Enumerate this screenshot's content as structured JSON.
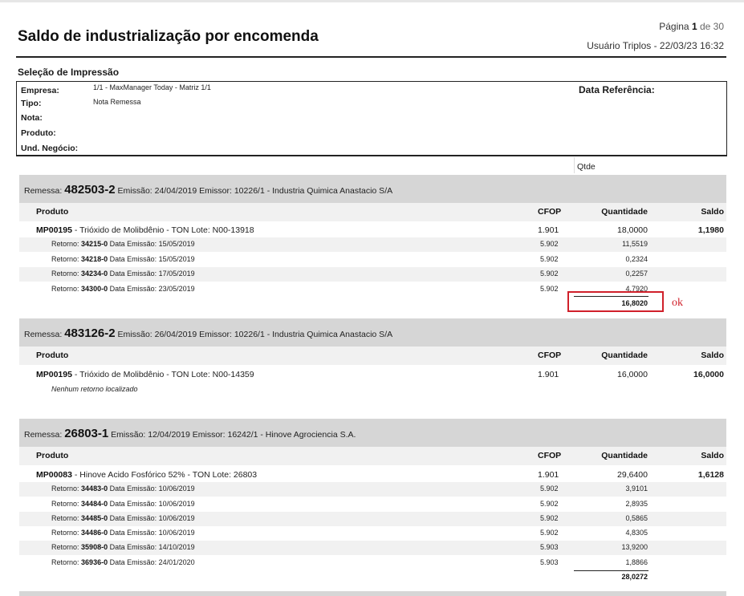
{
  "header": {
    "title": "Saldo de industrialização por encomenda",
    "page_word": "Página",
    "page_num": "1",
    "page_of": "de 30",
    "user_line": "Usuário Triplos - 22/03/23 16:32"
  },
  "selection": {
    "heading": "Seleção de Impressão",
    "empresa_label": "Empresa:",
    "empresa_value": "1/1 - MaxManager Today - Matriz 1/1",
    "tipo_label": "Tipo:",
    "tipo_value": "Nota Remessa",
    "nota_label": "Nota:",
    "produto_label": "Produto:",
    "und_label": "Und. Negócio:",
    "data_ref_label": "Data Referência:"
  },
  "qtde_label": "Qtde",
  "columns": {
    "produto": "Produto",
    "cfop": "CFOP",
    "quantidade": "Quantidade",
    "saldo": "Saldo"
  },
  "labels": {
    "remessa": "Remessa:",
    "retorno": "Retorno:",
    "data_emissao": "Data Emissão:"
  },
  "remessas": [
    {
      "numero": "482503-2",
      "info": "Emissão: 24/04/2019 Emissor: 10226/1 - Industria Quimica Anastacio S/A",
      "produto_code": "MP00195",
      "produto_desc": "- Trióxido de Molibdênio - TON Lote: N00-13918",
      "cfop": "1.901",
      "quantidade": "18,0000",
      "saldo": "1,1980",
      "retornos": [
        {
          "num": "34215-0",
          "data": "15/05/2019",
          "cfop": "5.902",
          "qtd": "11,5519"
        },
        {
          "num": "34218-0",
          "data": "15/05/2019",
          "cfop": "5.902",
          "qtd": "0,2324"
        },
        {
          "num": "34234-0",
          "data": "17/05/2019",
          "cfop": "5.902",
          "qtd": "0,2257"
        },
        {
          "num": "34300-0",
          "data": "23/05/2019",
          "cfop": "5.902",
          "qtd": "4,7920"
        }
      ],
      "total": "16,8020",
      "annotation": "ok"
    },
    {
      "numero": "483126-2",
      "info": "Emissão: 26/04/2019 Emissor: 10226/1 - Industria Quimica Anastacio S/A",
      "produto_code": "MP00195",
      "produto_desc": "- Trióxido de Molibdênio - TON Lote: N00-14359",
      "cfop": "1.901",
      "quantidade": "16,0000",
      "saldo": "16,0000",
      "no_return": "Nenhum retorno localizado"
    },
    {
      "numero": "26803-1",
      "info": "Emissão: 12/04/2019 Emissor: 16242/1 - Hinove Agrociencia S.A.",
      "produto_code": "MP00083",
      "produto_desc": "- Hinove Acido Fosfórico 52% - TON Lote: 26803",
      "cfop": "1.901",
      "quantidade": "29,6400",
      "saldo": "1,6128",
      "retornos": [
        {
          "num": "34483-0",
          "data": "10/06/2019",
          "cfop": "5.902",
          "qtd": "3,9101"
        },
        {
          "num": "34484-0",
          "data": "10/06/2019",
          "cfop": "5.902",
          "qtd": "2,8935"
        },
        {
          "num": "34485-0",
          "data": "10/06/2019",
          "cfop": "5.902",
          "qtd": "0,5865"
        },
        {
          "num": "34486-0",
          "data": "10/06/2019",
          "cfop": "5.902",
          "qtd": "4,8305"
        },
        {
          "num": "35908-0",
          "data": "14/10/2019",
          "cfop": "5.903",
          "qtd": "13,9200"
        },
        {
          "num": "36936-0",
          "data": "24/01/2020",
          "cfop": "5.903",
          "qtd": "1,8866"
        }
      ],
      "total": "28,0272"
    }
  ]
}
